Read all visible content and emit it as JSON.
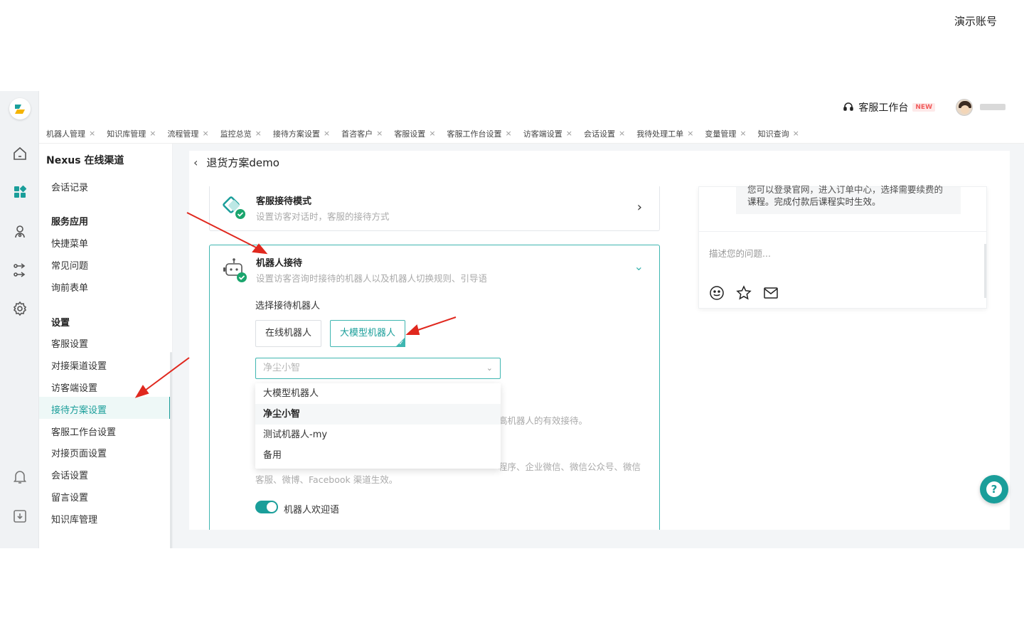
{
  "demo_account_label": "演示账号",
  "header": {
    "workspace_label": "客服工作台",
    "workspace_badge": "NEW"
  },
  "tabs": [
    {
      "label": "机器人管理"
    },
    {
      "label": "知识库管理"
    },
    {
      "label": "流程管理"
    },
    {
      "label": "监控总览"
    },
    {
      "label": "接待方案设置"
    },
    {
      "label": "首咨客户"
    },
    {
      "label": "客服设置"
    },
    {
      "label": "客服工作台设置"
    },
    {
      "label": "访客端设置"
    },
    {
      "label": "会话设置"
    },
    {
      "label": "我待处理工单"
    },
    {
      "label": "变量管理"
    },
    {
      "label": "知识查询"
    }
  ],
  "tab_close": "×",
  "nav": {
    "channel_title": "Nexus 在线渠道",
    "session_record": "会话记录",
    "service_group": "服务应用",
    "service_items": [
      "快捷菜单",
      "常见问题",
      "询前表单"
    ],
    "settings_group": "设置",
    "settings_items": [
      "客服设置",
      "对接渠道设置",
      "访客端设置",
      "接待方案设置",
      "客服工作台设置",
      "对接页面设置",
      "会话设置",
      "留言设置",
      "知识库管理"
    ],
    "active_item": "接待方案设置"
  },
  "page": {
    "back_icon": "‹",
    "title": "退货方案demo"
  },
  "card_agent_mode": {
    "title": "客服接待模式",
    "subtitle": "设置访客对话时，客服的接待方式",
    "arrow": "›"
  },
  "card_robot": {
    "title": "机器人接待",
    "subtitle": "设置访客咨询时接待的机器人以及机器人切换规则、引导语",
    "arrow": "⌄",
    "select_robot_label": "选择接待机器人",
    "robot_types": [
      {
        "label": "在线机器人",
        "selected": false
      },
      {
        "label": "大模型机器人",
        "selected": true
      }
    ],
    "robot_select": {
      "placeholder": "净尘小智",
      "caret": "⌄",
      "options": [
        {
          "label": "大模型机器人",
          "selected": false
        },
        {
          "label": "净尘小智",
          "selected": true
        },
        {
          "label": "测试机器人-my",
          "selected": false
        },
        {
          "label": "备用",
          "selected": false
        }
      ]
    },
    "partial_text_1": "高机器人的有效接待。",
    "partial_text_2": "程序、企业微信、微信公众号、微信",
    "partial_text_3": "客服、微博、Facebook 渠道生效。",
    "welcome_toggle_label": "机器人欢迎语",
    "welcome_toggle_on": true
  },
  "preview": {
    "cut_line": "您可以登录官网，进入订单中心，选择需要续费的",
    "message": "课程。完成付款后课程实时生效。",
    "input_placeholder": "描述您的问题..."
  },
  "help_button": "?",
  "colors": {
    "accent": "#1a9e9a",
    "annotation_arrow": "#e0281e"
  }
}
